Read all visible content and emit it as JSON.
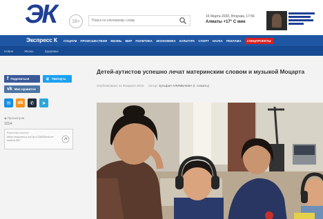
{
  "header": {
    "logo_text": "ЭК",
    "logo_subtext": "Экспресс К",
    "age_rating": "18+",
    "search_placeholder": "Поиск по ключевому слову",
    "date_text": "16 Марта 2020, Вторник, 17:56",
    "weather_city": "Алматы",
    "weather_temp": "+17° С мин"
  },
  "nav": {
    "brand": "Экспресс К",
    "items": [
      "СОЦИУМ",
      "ПРОИСШЕСТВИЯ",
      "ЖИЗНЬ",
      "МИР",
      "ПОЛИТИКА",
      "ЭКОНОМИКА",
      "КУЛЬТУРА",
      "СПОРТ",
      "НАУКА",
      "РЕКЛАМА",
      "СПЕЦПРОЕКТЫ"
    ],
    "special_index": 10
  },
  "subnav": {
    "items": [
      "Новое",
      "Жизнь",
      "Здоровье"
    ]
  },
  "sidebar": {
    "share_facebook": "Поделиться",
    "share_twitter": "Твитнуть",
    "share_vk": "Мне нравится",
    "views_label": "◉ Просмотров",
    "views_count": "1214",
    "short_link_label": "Короткая ссылка:",
    "short_link_url": "https://express-k.kz/?p=12345&ref=news&id=987"
  },
  "article": {
    "headline": "Детей-аутистов успешно лечат материнским словом и музыкой Моцарта",
    "date": "Опубликовано 11 Февраля 2019",
    "author_label": "Автор:",
    "author": "Зульфия АЛИМБАЕВА (г. Алматы)"
  },
  "colors": {
    "brand_blue": "#1f56a4",
    "logo_blue": "#1f3f95",
    "special_red": "#d82022",
    "facebook": "#3b5998",
    "twitter": "#1da1f2",
    "vk": "#4c75a3"
  }
}
